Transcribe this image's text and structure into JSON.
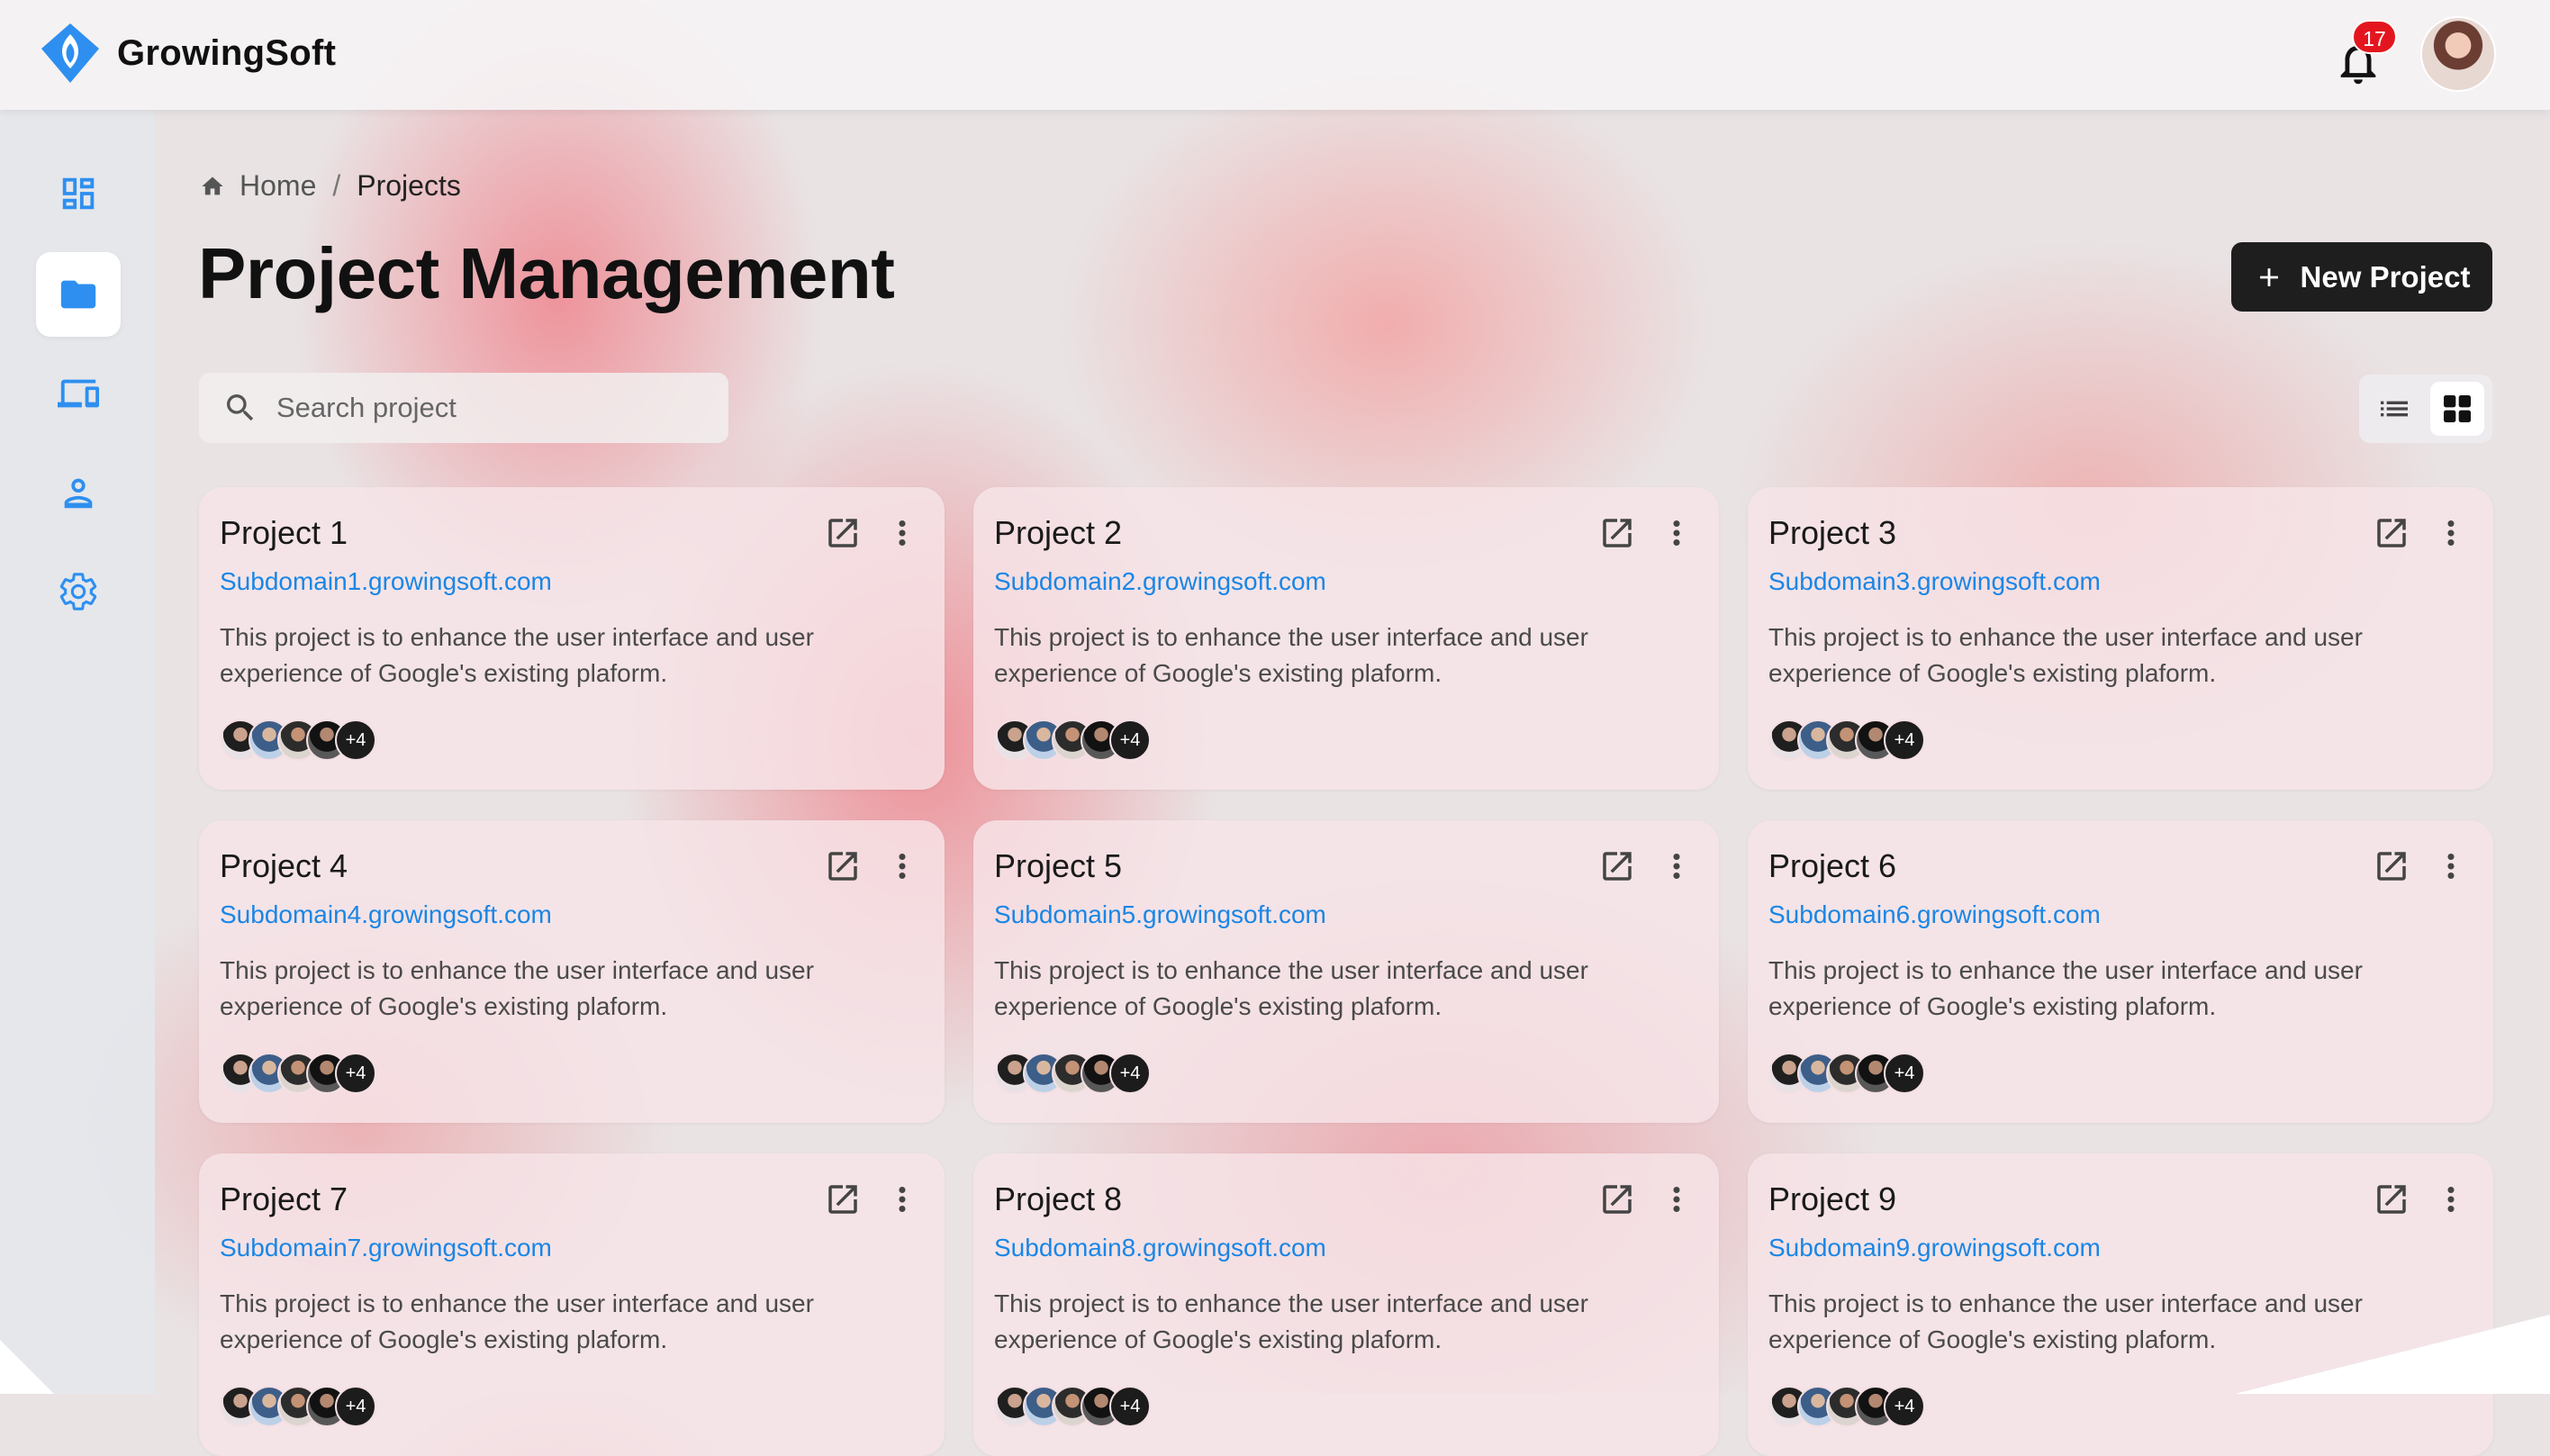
{
  "app": {
    "name": "GrowingSoft"
  },
  "header": {
    "notifications_count": "17"
  },
  "breadcrumb": {
    "home": "Home",
    "separator": "/",
    "current": "Projects"
  },
  "page": {
    "title": "Project Management",
    "new_button_label": "New Project"
  },
  "search": {
    "placeholder": "Search project",
    "value": ""
  },
  "colors": {
    "accent": "#1a86e6",
    "brand": "#2e8ff0",
    "primary_button": "#1e1e1e",
    "badge": "#e3161f"
  },
  "sidebar": {
    "items": [
      {
        "icon": "dashboard-icon",
        "active": false
      },
      {
        "icon": "folder-icon",
        "active": true
      },
      {
        "icon": "devices-icon",
        "active": false
      },
      {
        "icon": "user-icon",
        "active": false
      },
      {
        "icon": "gear-icon",
        "active": false
      }
    ]
  },
  "view_toggle": {
    "selected": "grid"
  },
  "projects": [
    {
      "title": "Project 1",
      "url": "Subdomain1.growingsoft.com",
      "description": "This project is to enhance the user interface and user experience of Google's existing plaform.",
      "members_more": "+4"
    },
    {
      "title": "Project 2",
      "url": "Subdomain2.growingsoft.com",
      "description": "This project is to enhance the user interface and user experience of Google's existing plaform.",
      "members_more": "+4"
    },
    {
      "title": "Project 3",
      "url": "Subdomain3.growingsoft.com",
      "description": "This project is to enhance the user interface and user experience of Google's existing plaform.",
      "members_more": "+4"
    },
    {
      "title": "Project 4",
      "url": "Subdomain4.growingsoft.com",
      "description": "This project is to enhance the user interface and user experience of Google's existing plaform.",
      "members_more": "+4"
    },
    {
      "title": "Project 5",
      "url": "Subdomain5.growingsoft.com",
      "description": "This project is to enhance the user interface and user experience of Google's existing plaform.",
      "members_more": "+4"
    },
    {
      "title": "Project 6",
      "url": "Subdomain6.growingsoft.com",
      "description": "This project is to enhance the user interface and user experience of Google's existing plaform.",
      "members_more": "+4"
    },
    {
      "title": "Project 7",
      "url": "Subdomain7.growingsoft.com",
      "description": "This project is to enhance the user interface and user experience of Google's existing plaform.",
      "members_more": "+4"
    },
    {
      "title": "Project 8",
      "url": "Subdomain8.growingsoft.com",
      "description": "This project is to enhance the user interface and user experience of Google's existing plaform.",
      "members_more": "+4"
    },
    {
      "title": "Project 9",
      "url": "Subdomain9.growingsoft.com",
      "description": "This project is to enhance the user interface and user experience of Google's existing plaform.",
      "members_more": "+4"
    }
  ]
}
